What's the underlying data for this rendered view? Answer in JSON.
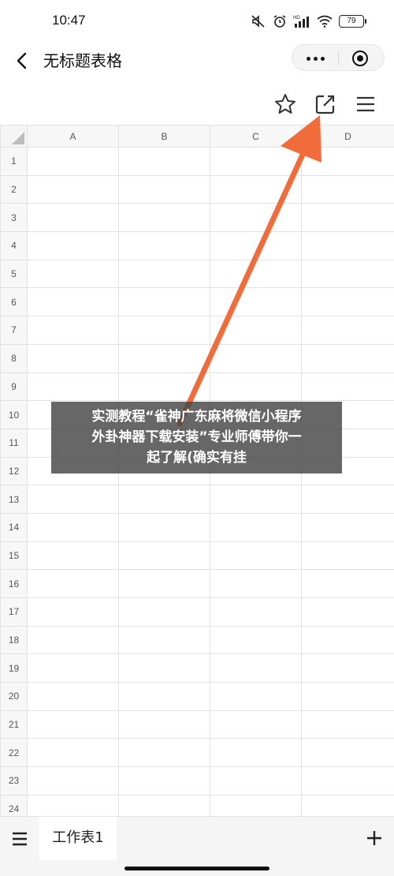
{
  "status_bar": {
    "time": "10:47",
    "battery": "79",
    "icons": [
      "mute-icon",
      "alarm-icon",
      "hd-signal-icon",
      "wifi-icon",
      "battery-icon"
    ]
  },
  "header": {
    "title": "无标题表格",
    "back_icon": "chevron-left-icon",
    "more_icon": "more-dots-icon",
    "close_icon": "mini-program-close-icon"
  },
  "toolbar": {
    "icons": [
      "star-icon",
      "share-external-icon",
      "menu-icon"
    ]
  },
  "sheet": {
    "columns": [
      "A",
      "B",
      "C",
      "D"
    ],
    "rows": [
      "1",
      "2",
      "3",
      "4",
      "5",
      "6",
      "7",
      "8",
      "9",
      "10",
      "11",
      "12",
      "13",
      "14",
      "15",
      "16",
      "17",
      "18",
      "19",
      "20",
      "21",
      "22",
      "23",
      "24"
    ]
  },
  "watermark": {
    "line1": "实测教程“雀神广东麻将微信小程序",
    "line2": "外卦神器下载安装”专业师傅带你一",
    "line3": "起了解(确实有挂"
  },
  "annotation": {
    "arrow_color": "#f26b3a",
    "points_to": "share-external-icon"
  },
  "bottom_bar": {
    "sheet_tab_label": "工作表1",
    "add_icon": "plus-icon",
    "menu_icon": "sheet-list-icon"
  }
}
